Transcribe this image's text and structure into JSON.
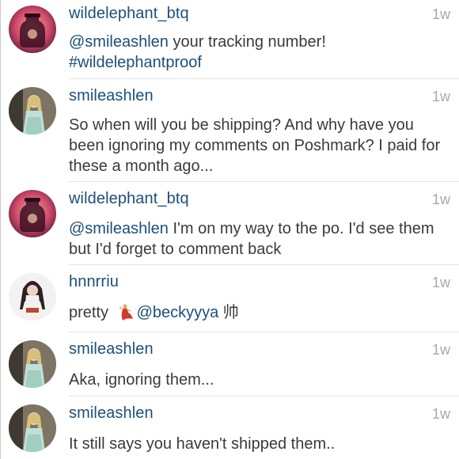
{
  "comments": [
    {
      "username": "wildelephant_btq",
      "time": "1w",
      "mention": "@smileashlen",
      "text": " your tracking number!",
      "hashtag": "#wildelephantproof"
    },
    {
      "username": "smileashlen",
      "time": "1w",
      "text": "So when will you be shipping? And why have you been ignoring my comments on Poshmark? I paid for these a month ago..."
    },
    {
      "username": "wildelephant_btq",
      "time": "1w",
      "mention": "@smileashlen",
      "text": " I'm on my way to the po. I'd see them but I'd forget to comment back"
    },
    {
      "username": "hnnrriu",
      "time": "1w",
      "text_before": "pretty ",
      "emoji": "dancer-emoji",
      "mention": "@beckyyya",
      "text_after": " 帅"
    },
    {
      "username": "smileashlen",
      "time": "1w",
      "text": "Aka, ignoring them..."
    },
    {
      "username": "smileashlen",
      "time": "1w",
      "text": "It still says you haven't shipped them.."
    }
  ],
  "icons": {
    "wildelephant_avatar": "jar-silhouette-avatar",
    "smileashlen_avatar": "woman-photo-avatar",
    "hnnrriu_avatar": "woman-photo-avatar"
  },
  "colors": {
    "username": "#1d4f78",
    "mention": "#1d4f78",
    "text": "#3a3a3a",
    "time": "#a8a8a8",
    "divider": "#e3e3e3"
  }
}
